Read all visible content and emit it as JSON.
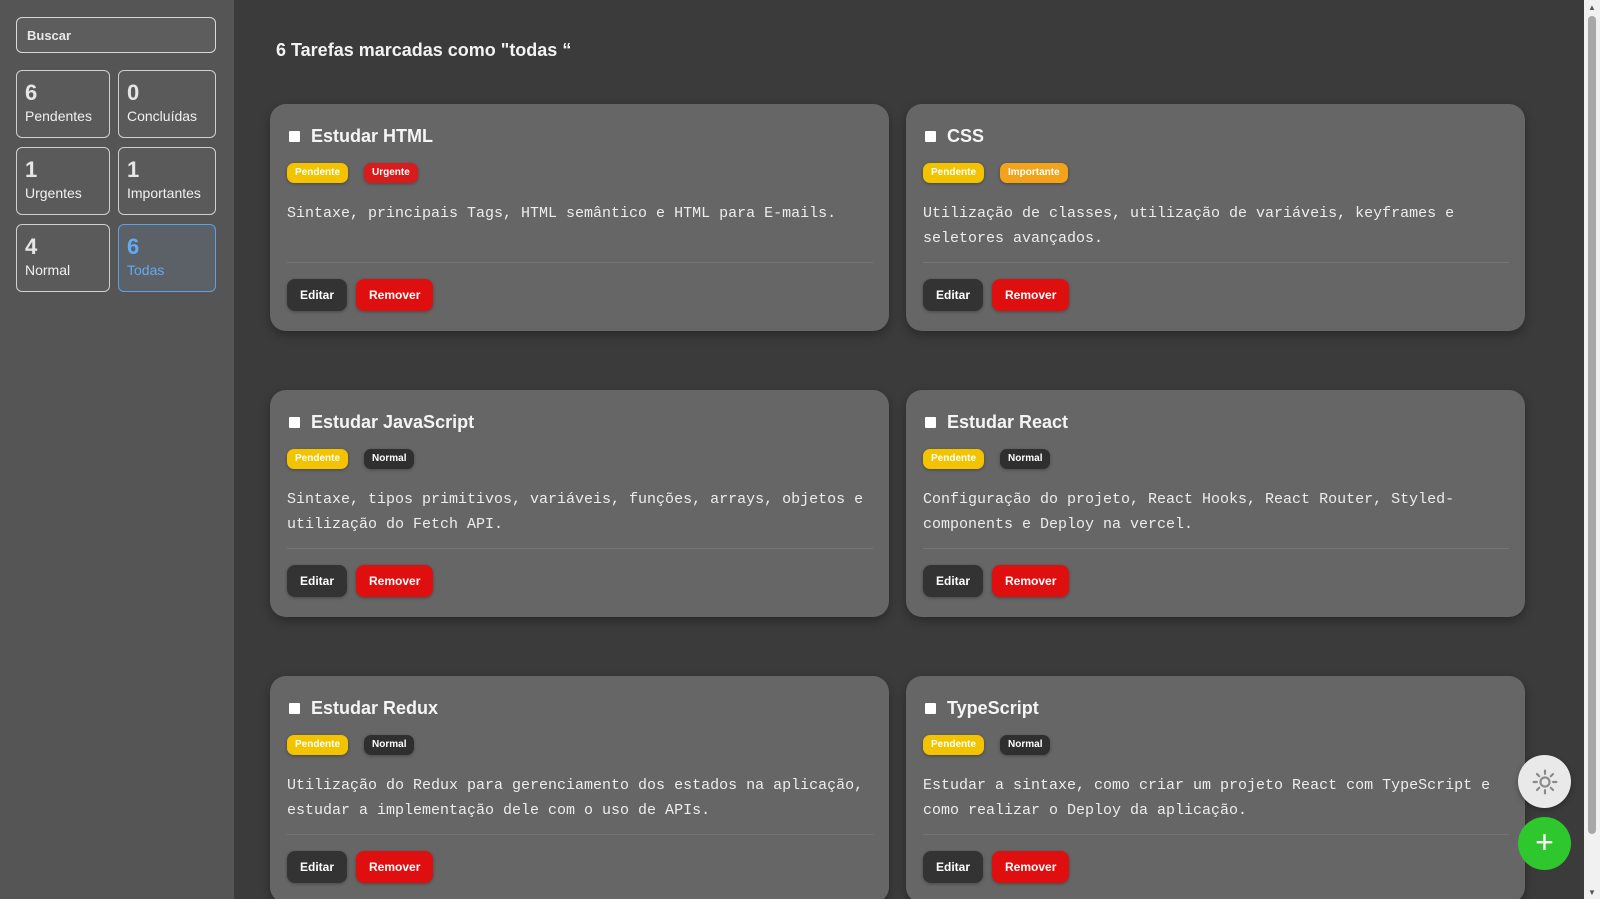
{
  "search": {
    "placeholder": "Buscar"
  },
  "stats": [
    {
      "count": "6",
      "label": "Pendentes"
    },
    {
      "count": "0",
      "label": "Concluídas"
    },
    {
      "count": "1",
      "label": "Urgentes"
    },
    {
      "count": "1",
      "label": "Importantes"
    },
    {
      "count": "4",
      "label": "Normal"
    },
    {
      "count": "6",
      "label": "Todas"
    }
  ],
  "heading": "6 Tarefas marcadas como \"todas “",
  "tasks": [
    {
      "title": "Estudar HTML",
      "status": "Pendente",
      "priority": "Urgente",
      "description": "Sintaxe, principais Tags, HTML semântico e HTML para E-mails.",
      "edit_label": "Editar",
      "remove_label": "Remover"
    },
    {
      "title": "CSS",
      "status": "Pendente",
      "priority": "Importante",
      "description": "Utilização de classes, utilização de variáveis, keyframes e seletores avançados.",
      "edit_label": "Editar",
      "remove_label": "Remover"
    },
    {
      "title": "Estudar JavaScript",
      "status": "Pendente",
      "priority": "Normal",
      "description": "Sintaxe, tipos primitivos, variáveis, funções, arrays, objetos e utilização do Fetch API.",
      "edit_label": "Editar",
      "remove_label": "Remover"
    },
    {
      "title": "Estudar React",
      "status": "Pendente",
      "priority": "Normal",
      "description": "Configuração do projeto, React Hooks, React Router, Styled-components e Deploy na vercel.",
      "edit_label": "Editar",
      "remove_label": "Remover"
    },
    {
      "title": "Estudar Redux",
      "status": "Pendente",
      "priority": "Normal",
      "description": "Utilização do Redux para gerenciamento dos estados na aplicação, estudar a implementação dele com o uso de APIs.",
      "edit_label": "Editar",
      "remove_label": "Remover"
    },
    {
      "title": "TypeScript",
      "status": "Pendente",
      "priority": "Normal",
      "description": "Estudar a sintaxe, como criar um projeto React com TypeScript e como realizar o Deploy da aplicação.",
      "edit_label": "Editar",
      "remove_label": "Remover"
    }
  ],
  "buttons": {
    "add_label": "+",
    "theme_icon": "sun-icon"
  },
  "colors": {
    "pendente": "#f3c300",
    "urgente": "#d81b1b",
    "importante": "#f3a31a",
    "normal": "#2f2f2f",
    "remove": "#e00f0f",
    "add": "#2ec82e",
    "active": "#63aaf0"
  }
}
